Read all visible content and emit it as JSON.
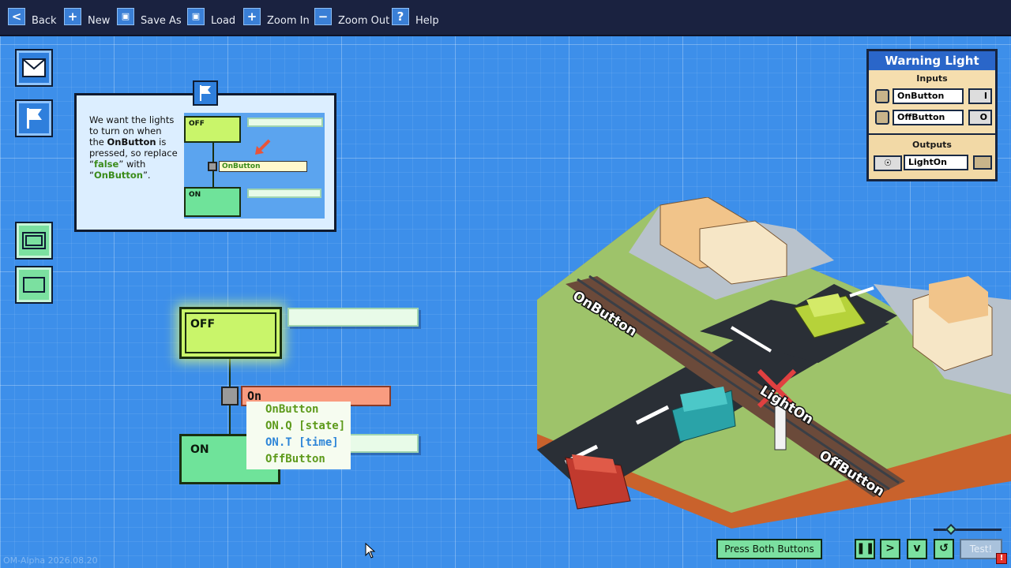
{
  "toolbar": {
    "back": "Back",
    "new": "New",
    "save_as": "Save As",
    "load": "Load",
    "zoom_in": "Zoom In",
    "zoom_out": "Zoom Out",
    "help": "Help"
  },
  "hint": {
    "line1": "We want the lights",
    "line2": "to turn on when",
    "line3_pre": "the ",
    "line3_bold": "OnButton",
    "line3_post": " is",
    "line4": "pressed, so replace",
    "q_open": "“",
    "false_word": "false",
    "line5_post": "” with",
    "onbutton_word": "OnButton",
    "line6_end": "”.",
    "mini_off": "OFF",
    "mini_on": "ON",
    "mini_condition": "OnButton"
  },
  "diagram": {
    "off_label": "OFF",
    "on_label": "ON",
    "condition_input": "On"
  },
  "autocomplete": [
    {
      "text": "OnButton",
      "color": "#5d9a1b"
    },
    {
      "text": "ON.Q [state]",
      "color": "#5d9a1b"
    },
    {
      "text": "ON.T [time]",
      "color": "#2f86d8"
    },
    {
      "text": "OffButton",
      "color": "#5d9a1b"
    }
  ],
  "panel": {
    "title": "Warning Light",
    "inputs_label": "Inputs",
    "input1": "OnButton",
    "input2": "OffButton",
    "outputs_label": "Outputs",
    "output1": "LightOn"
  },
  "scene": {
    "label_onbutton": "OnButton",
    "label_lighton": "LightOn",
    "label_offbutton": "OffButton"
  },
  "bottom": {
    "press_label": "Press Both Buttons",
    "test_label": "Test!",
    "version": "OM-Alpha  2026.08.20"
  },
  "colors": {
    "grid_bg": "#3d8fea",
    "off_state": "#c9f56a",
    "on_state": "#6fe39a",
    "topbar": "#1a2240"
  }
}
